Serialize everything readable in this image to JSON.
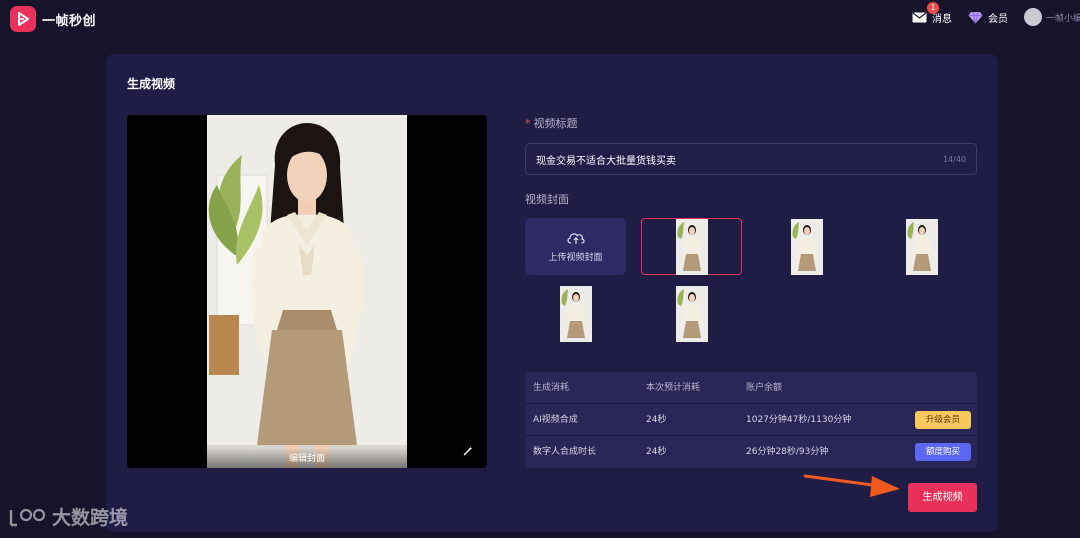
{
  "app": {
    "name": "一帧秒创",
    "brand_color": "#e8325c"
  },
  "header": {
    "messages_label": "消息",
    "messages_badge": "1",
    "member_label": "会员",
    "username": "一帧小编"
  },
  "page": {
    "title": "生成视频"
  },
  "preview": {
    "edit_cover_label": "编辑封面"
  },
  "form": {
    "title_label": "视频标题",
    "title_value": "现金交易不适合大批量货钱买卖",
    "title_counter": "14/40",
    "cover_label": "视频封面",
    "upload_cover_label": "上传视频封面",
    "selected_cover_index": 0
  },
  "cost": {
    "headers": [
      "生成消耗",
      "本次预计消耗",
      "账户余额"
    ],
    "rows": [
      {
        "item": "AI视频合成",
        "estimate": "24秒",
        "balance": "1027分钟47秒/1130分钟",
        "action": "升级会员"
      },
      {
        "item": "数字人合成时长",
        "estimate": "24秒",
        "balance": "26分钟28秒/93分钟",
        "action": "额度购买"
      }
    ]
  },
  "actions": {
    "generate_label": "生成视频"
  },
  "watermark": {
    "text": "大数跨境"
  }
}
